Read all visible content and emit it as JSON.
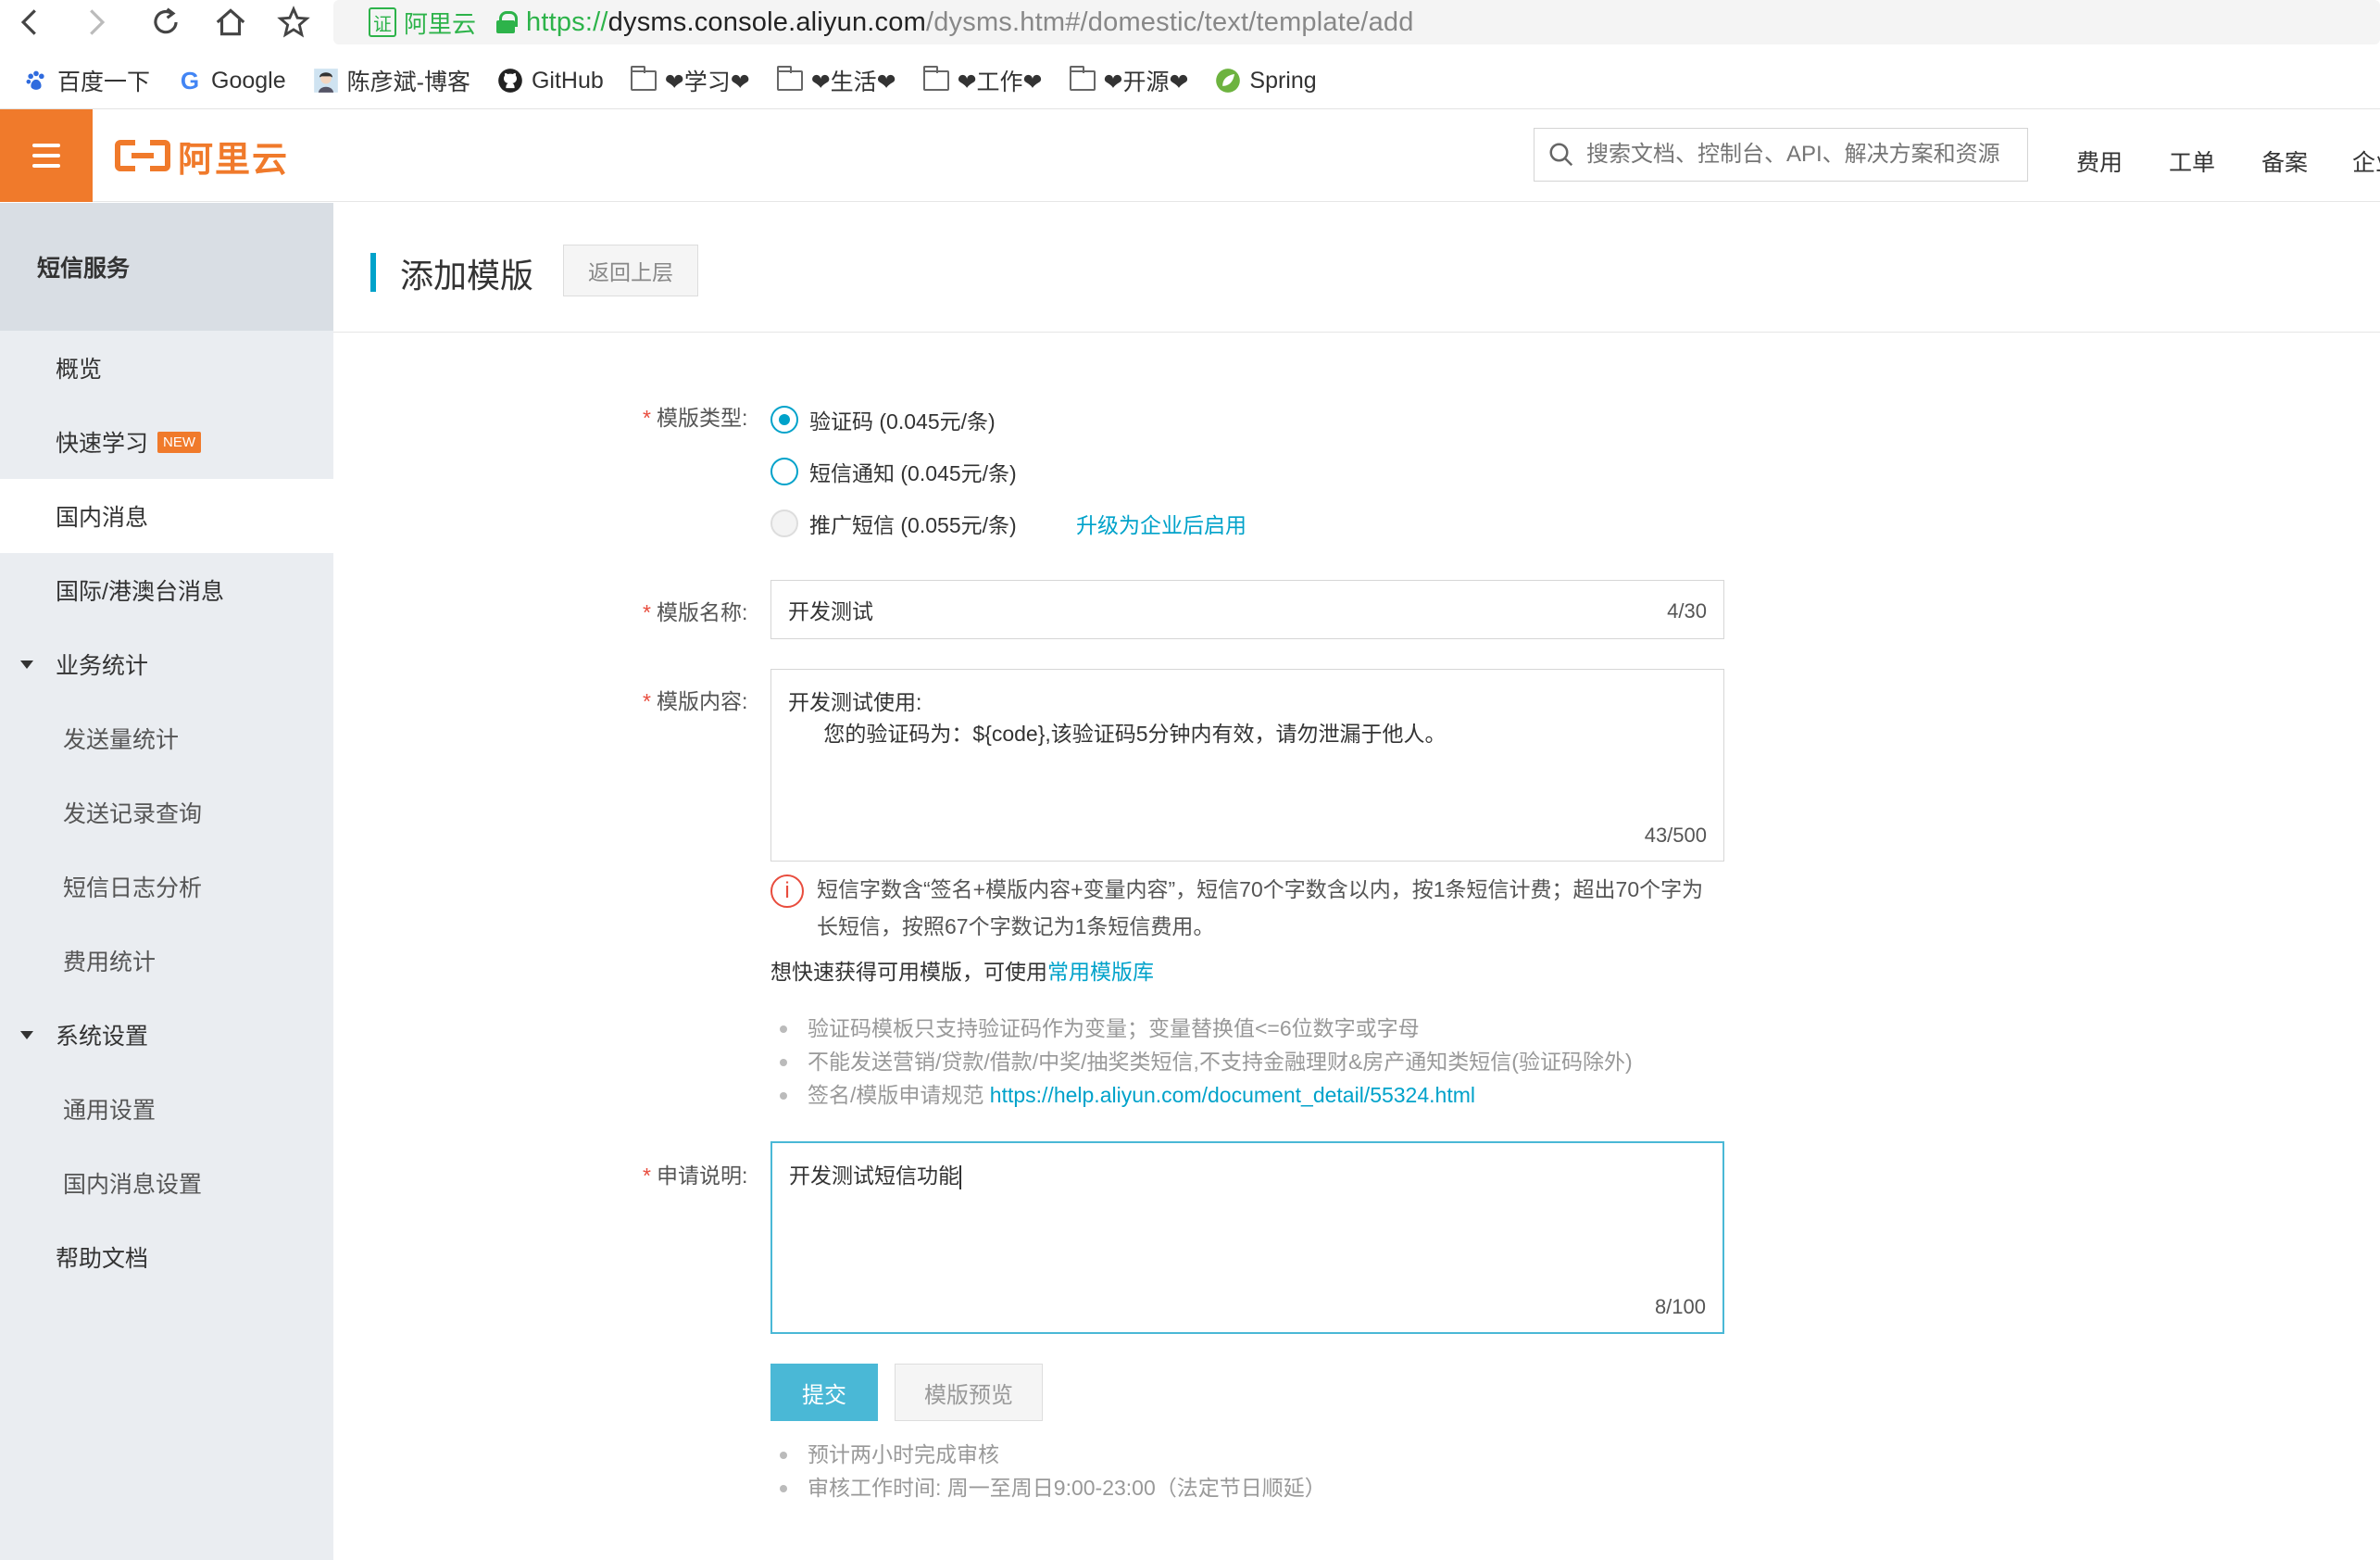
{
  "browser": {
    "url_scheme": "https://",
    "url_host": "dysms.console.aliyun.com",
    "url_path": "/dysms.htm#/domestic/text/template/add",
    "cert_label": "阿里云",
    "cert_icon_text": "证",
    "bookmarks": [
      {
        "label": "百度一下",
        "icon": "baidu-paw-icon"
      },
      {
        "label": "Google",
        "icon": "google-g-icon"
      },
      {
        "label": "陈彦斌-博客",
        "icon": "avatar-icon"
      },
      {
        "label": "GitHub",
        "icon": "github-icon"
      },
      {
        "label": "❤学习❤",
        "icon": "folder-icon"
      },
      {
        "label": "❤生活❤",
        "icon": "folder-icon"
      },
      {
        "label": "❤工作❤",
        "icon": "folder-icon"
      },
      {
        "label": "❤开源❤",
        "icon": "folder-icon"
      },
      {
        "label": "Spring",
        "icon": "spring-leaf-icon"
      }
    ]
  },
  "console": {
    "logo_text": "阿里云",
    "search_placeholder": "搜索文档、控制台、API、解决方案和资源",
    "links": [
      "费用",
      "工单",
      "备案",
      "企业"
    ]
  },
  "sidebar": {
    "title": "短信服务",
    "items": [
      {
        "label": "概览"
      },
      {
        "label": "快速学习",
        "badge": "NEW"
      },
      {
        "label": "国内消息"
      },
      {
        "label": "国际/港澳台消息"
      },
      {
        "label": "业务统计"
      },
      {
        "label": "发送量统计"
      },
      {
        "label": "发送记录查询"
      },
      {
        "label": "短信日志分析"
      },
      {
        "label": "费用统计"
      },
      {
        "label": "系统设置"
      },
      {
        "label": "通用设置"
      },
      {
        "label": "国内消息设置"
      },
      {
        "label": "帮助文档"
      }
    ]
  },
  "page": {
    "title": "添加模版",
    "back_label": "返回上层"
  },
  "form": {
    "required_mark": "*",
    "type_label": "模版类型:",
    "type_options": [
      {
        "label": "验证码 (0.045元/条)",
        "state": "checked"
      },
      {
        "label": "短信通知 (0.045元/条)",
        "state": "unchecked"
      },
      {
        "label": "推广短信 (0.055元/条)",
        "state": "disabled"
      }
    ],
    "upgrade_link": "升级为企业后启用",
    "name_label": "模版名称:",
    "name_value": "开发测试",
    "name_counter": "4/30",
    "content_label": "模版内容:",
    "content_value": "开发测试使用:\n      您的验证码为：${code},该验证码5分钟内有效，请勿泄漏于他人。",
    "content_counter": "43/500",
    "notice_icon": "i",
    "notice_text": "短信字数含“签名+模版内容+变量内容”，短信70个字数含以内，按1条短信计费；超出70个字为长短信，按照67个字数记为1条短信费用。",
    "library_prefix": "想快速获得可用模版，可使用",
    "library_link": "常用模版库",
    "tips": [
      "验证码模板只支持验证码作为变量；变量替换值<=6位数字或字母",
      "不能发送营销/贷款/借款/中奖/抽奖类短信,不支持金融理财&房产通知类短信(验证码除外)"
    ],
    "tip_spec_prefix": "签名/模版申请规范 ",
    "tip_spec_link": "https://help.aliyun.com/document_detail/55324.html",
    "reason_label": "申请说明:",
    "reason_value": "开发测试短信功能",
    "reason_counter": "8/100",
    "submit_label": "提交",
    "preview_label": "模版预览",
    "review_tips": [
      "预计两小时完成审核",
      "审核工作时间: 周一至周日9:00-23:00（法定节日顺延）"
    ]
  },
  "colors": {
    "brand_orange": "#f07a2b",
    "accent_blue": "#00a2ca",
    "required_red": "#e84c3d"
  }
}
